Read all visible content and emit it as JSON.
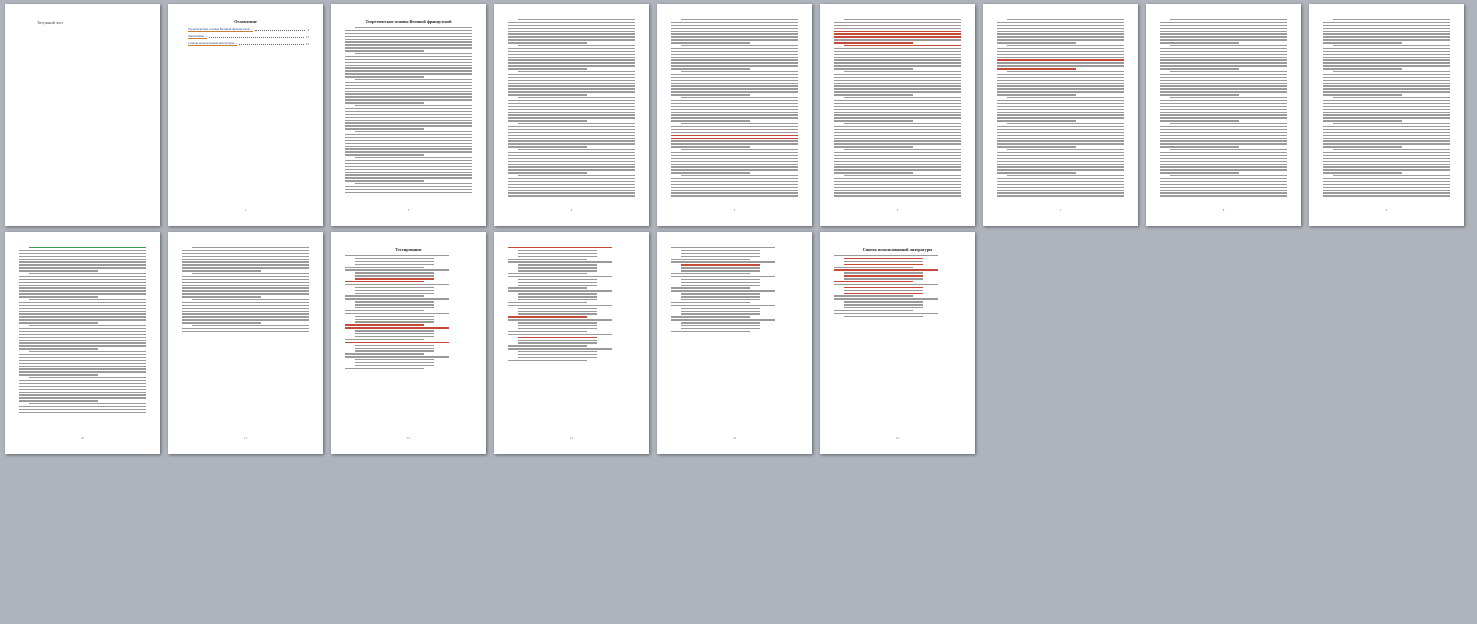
{
  "pages": [
    {
      "title": "Титульный лист",
      "number": ""
    },
    {
      "title": "Оглавление",
      "number": "2",
      "toc": [
        {
          "label": "Теоретические основы Великой французской ...",
          "page": "3"
        },
        {
          "label": "Заключение ...",
          "page": "11"
        },
        {
          "label": "Список используемой литературы ...",
          "page": "12"
        }
      ]
    },
    {
      "title": "Теоретические основы Великой французской",
      "number": "3"
    },
    {
      "title": "",
      "number": "4"
    },
    {
      "title": "",
      "number": "5"
    },
    {
      "title": "",
      "number": "6"
    },
    {
      "title": "",
      "number": "7"
    },
    {
      "title": "",
      "number": "8"
    },
    {
      "title": "",
      "number": "9"
    },
    {
      "title": "",
      "number": "10"
    },
    {
      "title": "",
      "number": "11"
    },
    {
      "title": "Тестирование",
      "number": "12"
    },
    {
      "title": "",
      "number": "13"
    },
    {
      "title": "",
      "number": "14"
    },
    {
      "title": "Список использованной литературы",
      "number": "15"
    }
  ],
  "colors": {
    "background": "#aeb3bc",
    "page": "#ffffff",
    "text_line": "#9a9a9a",
    "highlight_red": "#c44a3a",
    "highlight_green": "#3e9b4a",
    "link": "#1c3d8f"
  }
}
